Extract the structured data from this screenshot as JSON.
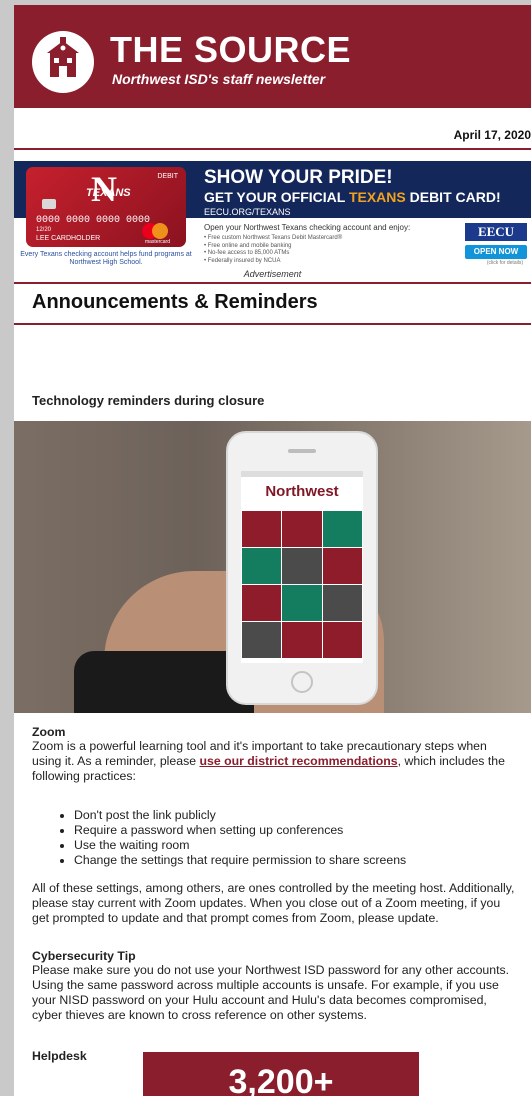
{
  "newsletter": {
    "title": "THE SOURCE",
    "subtitle": "Northwest ISD's staff newsletter",
    "date": "April 17, 2020"
  },
  "ad": {
    "card": {
      "brand": "TEXANS",
      "debit": "DEBIT",
      "number": "0000 0000 0000 0000",
      "expiry": "12/20",
      "holder": "LEE CARDHOLDER",
      "network": "mastercard"
    },
    "card_caption": "Every Texans checking account helps fund programs at Northwest High School.",
    "headline": "SHOW YOUR PRIDE!",
    "sub_before": "GET YOUR OFFICIAL ",
    "sub_accent": "TEXANS",
    "sub_after": " DEBIT CARD!",
    "url": "EECU.ORG/TEXANS",
    "copy": "Open your Northwest Texans checking account and enjoy:",
    "bullets": [
      "• Free custom Northwest Texans Debit Mastercard®",
      "• Free online and mobile banking",
      "• No-fee access to 85,000 ATMs",
      "• Federally insured by NCUA"
    ],
    "logo": "EECU",
    "cta": "OPEN NOW",
    "cta_note": "(click for details)",
    "label": "Advertisement"
  },
  "section": {
    "heading": "Announcements & Reminders",
    "subheading": "Technology reminders during closure"
  },
  "photo": {
    "app_name": "Northwest"
  },
  "zoom": {
    "heading": "Zoom",
    "intro_before": "Zoom is a powerful learning tool and it's important to take precautionary steps when using it. As a reminder, please ",
    "link": "use our district recommendations",
    "intro_after": ", which includes the following practices:",
    "practices": [
      "Don't post the link publicly",
      "Require a password when setting up conferences",
      "Use the waiting room",
      "Change the settings that require permission to share screens"
    ],
    "closing": "All of these settings, among others, are ones controlled by the meeting host. Additionally, please stay current with Zoom updates. When you close out of a Zoom meeting, if you get prompted to update and that prompt comes from Zoom, please update."
  },
  "cyber": {
    "heading": "Cybersecurity Tip",
    "text": "Please make sure you do not use your Northwest ISD password for any other accounts. Using the same password across multiple accounts is unsafe. For example, if you use your NISD password on your Hulu account and Hulu's data becomes compromised, cyber thieves are known to cross reference on other systems."
  },
  "helpdesk": {
    "heading": "Helpdesk"
  },
  "stat": {
    "value": "3,200+"
  },
  "colors": {
    "brand": "#8b1e2d",
    "ad_navy": "#13275a",
    "ad_accent": "#f0a21e"
  }
}
